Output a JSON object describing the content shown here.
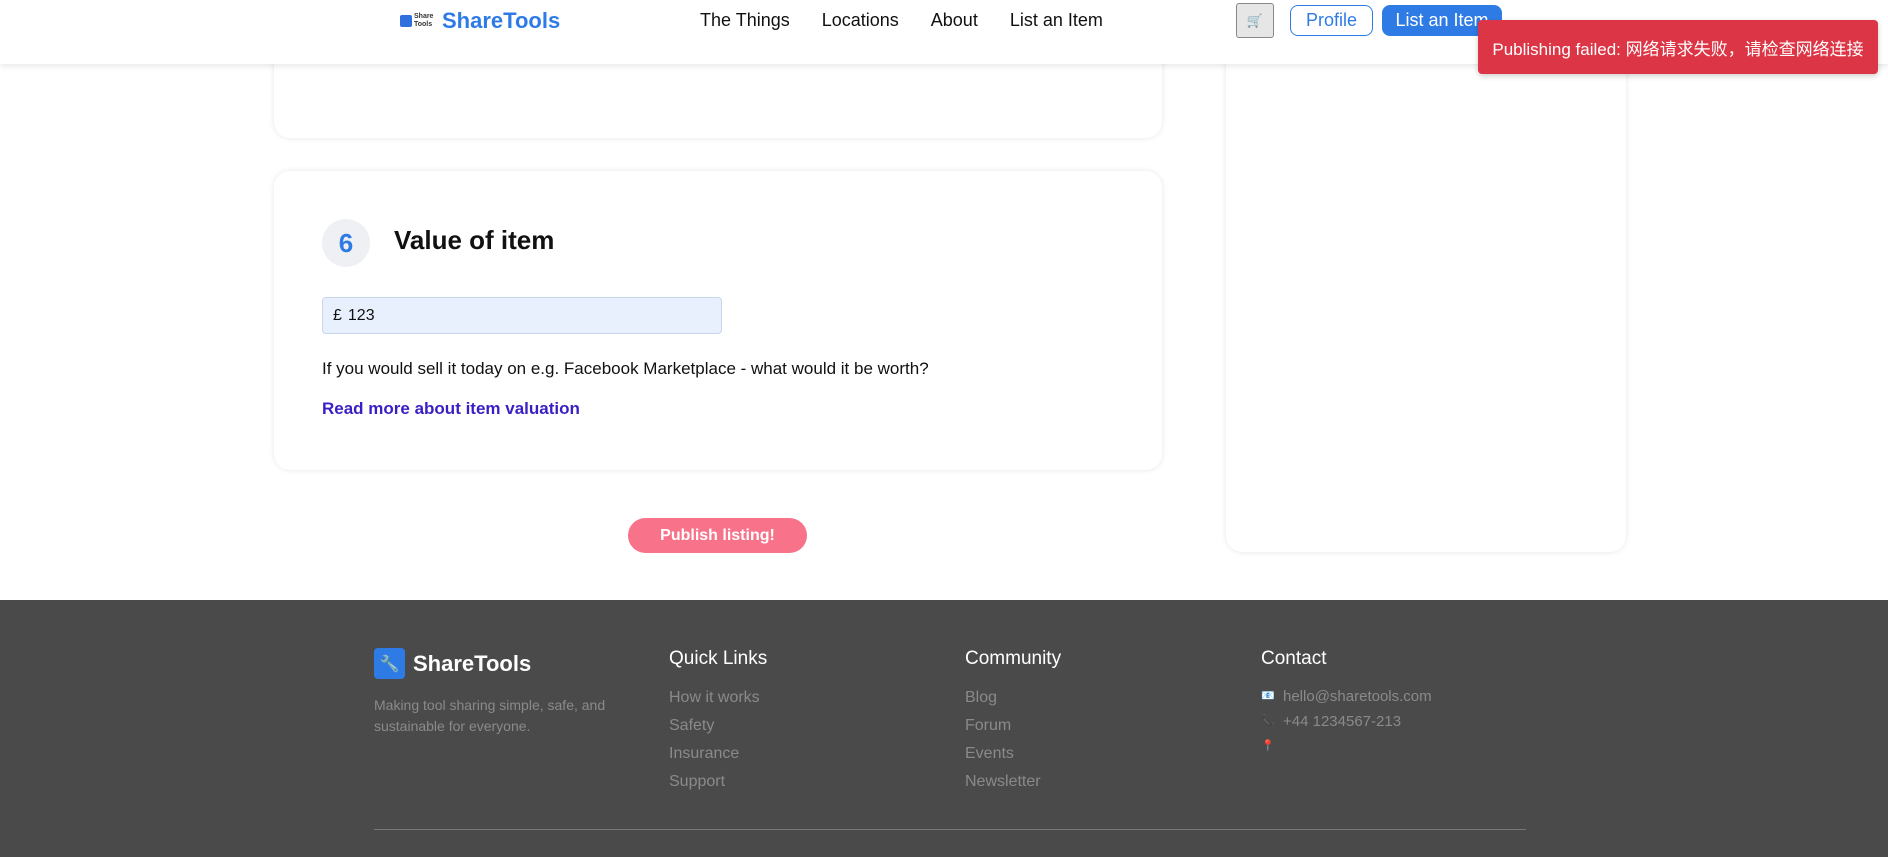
{
  "header": {
    "logo_small_text": "Share Tools",
    "logo_text": "ShareTools",
    "nav": [
      "The Things",
      "Locations",
      "About",
      "List an Item"
    ],
    "cart_icon": "cart-icon",
    "profile_label": "Profile",
    "list_item_label": "List an Item"
  },
  "toast": {
    "message": "Publishing failed: 网络请求失败，请检查网络连接",
    "color": "#dc3545"
  },
  "value_section": {
    "step_number": "6",
    "title": "Value of item",
    "currency": "£",
    "value": "123",
    "helper": "If you would sell it today on e.g. Facebook Marketplace - what would it be worth?",
    "read_more": "Read more about item valuation"
  },
  "publish_label": "Publish listing!",
  "footer": {
    "brand": "ShareTools",
    "tagline": "Making tool sharing simple, safe, and sustainable for everyone.",
    "quick_links": {
      "title": "Quick Links",
      "items": [
        "How it works",
        "Safety",
        "Insurance",
        "Support"
      ]
    },
    "community": {
      "title": "Community",
      "items": [
        "Blog",
        "Forum",
        "Events",
        "Newsletter"
      ]
    },
    "contact": {
      "title": "Contact",
      "email": "hello@sharetools.com",
      "phone": "+44 1234567-213",
      "address": ""
    }
  },
  "colors": {
    "accent": "#2f7be6",
    "publish": "#f8728a",
    "footer_bg": "#4a4a4a",
    "link": "#3a1fc4"
  }
}
